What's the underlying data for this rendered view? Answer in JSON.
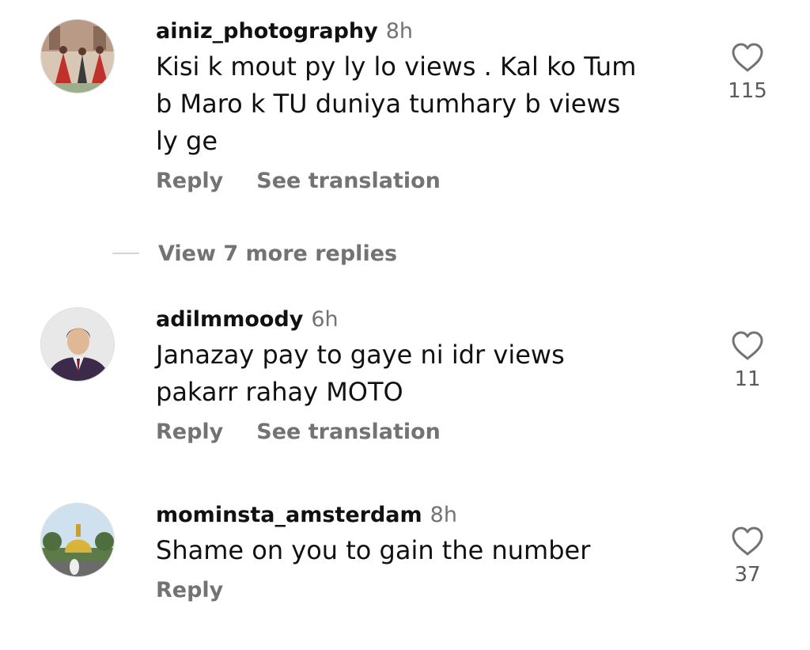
{
  "comments": [
    {
      "username": "ainiz_photography",
      "time": "8h",
      "text": "Kisi k mout py ly lo views . Kal ko Tum\nb Maro k TU duniya tumhary b views\nly ge",
      "reply_label": "Reply",
      "translate_label": "See translation",
      "like_count": "115",
      "avatar_icon": "avatar-photo-bride-group"
    },
    {
      "username": "adilmmoody",
      "time": "6h",
      "text": "Janazay pay to gaye ni idr views\npakarr rahay MOTO",
      "reply_label": "Reply",
      "translate_label": "See translation",
      "like_count": "11",
      "avatar_icon": "avatar-photo-man-suit"
    },
    {
      "username": "mominsta_amsterdam",
      "time": "8h",
      "text": "Shame on you to gain the number",
      "reply_label": "Reply",
      "like_count": "37",
      "avatar_icon": "avatar-photo-landmark"
    }
  ],
  "view_more_replies": "View 7 more replies",
  "colors": {
    "text": "#111111",
    "secondary": "#737373",
    "heart_stroke": "#737373"
  }
}
